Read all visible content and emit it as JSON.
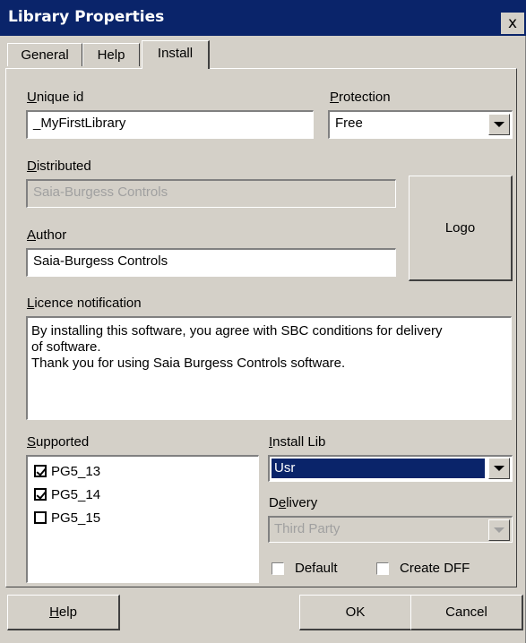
{
  "window": {
    "title": "Library Properties",
    "close_glyph": "x"
  },
  "tabs": [
    {
      "label": "General"
    },
    {
      "label": "Help"
    },
    {
      "label": "Install"
    }
  ],
  "unique_id": {
    "label_mn": "U",
    "label_rest": "nique id",
    "value": "_MyFirstLibrary"
  },
  "protection": {
    "label_mn": "P",
    "label_rest": "rotection",
    "value": "Free"
  },
  "distributed": {
    "label_mn": "D",
    "label_rest": "istributed",
    "value": "Saia-Burgess Controls"
  },
  "author": {
    "label_mn": "A",
    "label_rest": "uthor",
    "value": "Saia-Burgess Controls"
  },
  "logo": {
    "label": "Logo"
  },
  "licence": {
    "label_mn": "L",
    "label_rest": "icence notification",
    "line1": "By installing this software, you agree with  SBC  conditions for delivery",
    "line2": "of software.",
    "line3": "Thank you for using Saia Burgess Controls software."
  },
  "supported": {
    "label_mn": "S",
    "label_rest": "upported",
    "items": [
      {
        "label": "PG5_13",
        "checked": true
      },
      {
        "label": "PG5_14",
        "checked": true
      },
      {
        "label": "PG5_15",
        "checked": false
      }
    ]
  },
  "install_lib": {
    "label_mn": "I",
    "label_rest": "nstall Lib",
    "value": "Usr"
  },
  "delivery": {
    "label_pre": "D",
    "label_mn": "e",
    "label_rest": "livery",
    "value": "Third Party"
  },
  "options": {
    "default_label": "Default",
    "create_dff_label": "Create DFF"
  },
  "buttons": {
    "help_mn": "H",
    "help_rest": "elp",
    "ok": "OK",
    "cancel": "Cancel"
  },
  "colors": {
    "titlebar": "#0a246a",
    "face": "#d4d0c8",
    "selection": "#0a246a"
  }
}
